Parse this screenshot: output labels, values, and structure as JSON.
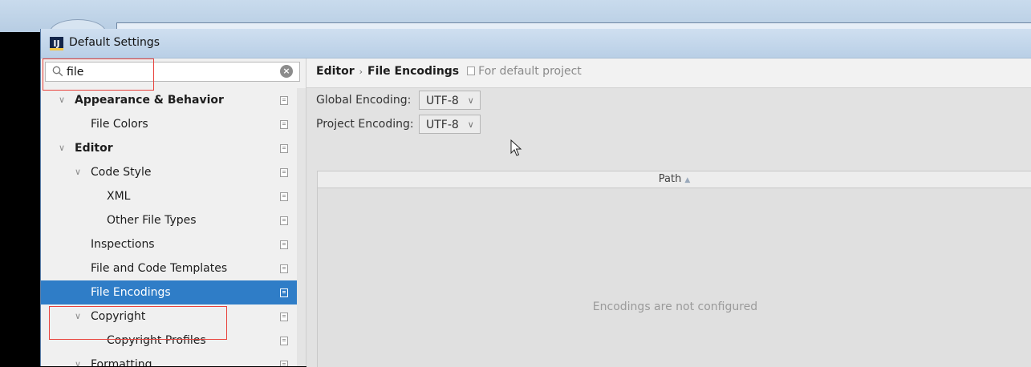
{
  "window": {
    "title": "Default Settings",
    "app_icon": "IJ"
  },
  "search": {
    "value": "file"
  },
  "tree": [
    {
      "label": "Appearance & Behavior",
      "expanded": true,
      "bold": true
    },
    {
      "label": "File Colors"
    },
    {
      "label": "Editor",
      "expanded": true,
      "bold": true
    },
    {
      "label": "Code Style",
      "expanded": true
    },
    {
      "label": "XML"
    },
    {
      "label": "Other File Types"
    },
    {
      "label": "Inspections"
    },
    {
      "label": "File and Code Templates"
    },
    {
      "label": "File Encodings",
      "selected": true
    },
    {
      "label": "Copyright",
      "expanded": true
    },
    {
      "label": "Copyright Profiles"
    },
    {
      "label": "Formatting",
      "expanded": true
    }
  ],
  "breadcrumb": {
    "parent": "Editor",
    "separator": "›",
    "current": "File Encodings",
    "note": "For default project"
  },
  "encodings": {
    "global_label": "Global Encoding:",
    "global_value": "UTF-8",
    "project_label": "Project Encoding:",
    "project_value": "UTF-8"
  },
  "table": {
    "column_path": "Path",
    "sort_indicator": "▲",
    "empty_text": "Encodings are not configured"
  },
  "colors": {
    "selection": "#2f7dc7",
    "highlight": "#e8433d"
  }
}
